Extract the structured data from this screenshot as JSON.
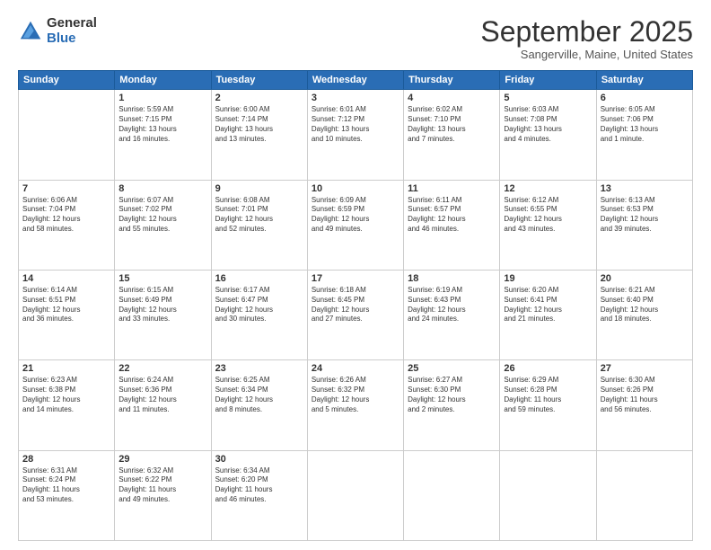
{
  "logo": {
    "general": "General",
    "blue": "Blue"
  },
  "title": "September 2025",
  "subtitle": "Sangerville, Maine, United States",
  "days": [
    "Sunday",
    "Monday",
    "Tuesday",
    "Wednesday",
    "Thursday",
    "Friday",
    "Saturday"
  ],
  "weeks": [
    [
      {
        "day": "",
        "content": ""
      },
      {
        "day": "1",
        "content": "Sunrise: 5:59 AM\nSunset: 7:15 PM\nDaylight: 13 hours\nand 16 minutes."
      },
      {
        "day": "2",
        "content": "Sunrise: 6:00 AM\nSunset: 7:14 PM\nDaylight: 13 hours\nand 13 minutes."
      },
      {
        "day": "3",
        "content": "Sunrise: 6:01 AM\nSunset: 7:12 PM\nDaylight: 13 hours\nand 10 minutes."
      },
      {
        "day": "4",
        "content": "Sunrise: 6:02 AM\nSunset: 7:10 PM\nDaylight: 13 hours\nand 7 minutes."
      },
      {
        "day": "5",
        "content": "Sunrise: 6:03 AM\nSunset: 7:08 PM\nDaylight: 13 hours\nand 4 minutes."
      },
      {
        "day": "6",
        "content": "Sunrise: 6:05 AM\nSunset: 7:06 PM\nDaylight: 13 hours\nand 1 minute."
      }
    ],
    [
      {
        "day": "7",
        "content": "Sunrise: 6:06 AM\nSunset: 7:04 PM\nDaylight: 12 hours\nand 58 minutes."
      },
      {
        "day": "8",
        "content": "Sunrise: 6:07 AM\nSunset: 7:02 PM\nDaylight: 12 hours\nand 55 minutes."
      },
      {
        "day": "9",
        "content": "Sunrise: 6:08 AM\nSunset: 7:01 PM\nDaylight: 12 hours\nand 52 minutes."
      },
      {
        "day": "10",
        "content": "Sunrise: 6:09 AM\nSunset: 6:59 PM\nDaylight: 12 hours\nand 49 minutes."
      },
      {
        "day": "11",
        "content": "Sunrise: 6:11 AM\nSunset: 6:57 PM\nDaylight: 12 hours\nand 46 minutes."
      },
      {
        "day": "12",
        "content": "Sunrise: 6:12 AM\nSunset: 6:55 PM\nDaylight: 12 hours\nand 43 minutes."
      },
      {
        "day": "13",
        "content": "Sunrise: 6:13 AM\nSunset: 6:53 PM\nDaylight: 12 hours\nand 39 minutes."
      }
    ],
    [
      {
        "day": "14",
        "content": "Sunrise: 6:14 AM\nSunset: 6:51 PM\nDaylight: 12 hours\nand 36 minutes."
      },
      {
        "day": "15",
        "content": "Sunrise: 6:15 AM\nSunset: 6:49 PM\nDaylight: 12 hours\nand 33 minutes."
      },
      {
        "day": "16",
        "content": "Sunrise: 6:17 AM\nSunset: 6:47 PM\nDaylight: 12 hours\nand 30 minutes."
      },
      {
        "day": "17",
        "content": "Sunrise: 6:18 AM\nSunset: 6:45 PM\nDaylight: 12 hours\nand 27 minutes."
      },
      {
        "day": "18",
        "content": "Sunrise: 6:19 AM\nSunset: 6:43 PM\nDaylight: 12 hours\nand 24 minutes."
      },
      {
        "day": "19",
        "content": "Sunrise: 6:20 AM\nSunset: 6:41 PM\nDaylight: 12 hours\nand 21 minutes."
      },
      {
        "day": "20",
        "content": "Sunrise: 6:21 AM\nSunset: 6:40 PM\nDaylight: 12 hours\nand 18 minutes."
      }
    ],
    [
      {
        "day": "21",
        "content": "Sunrise: 6:23 AM\nSunset: 6:38 PM\nDaylight: 12 hours\nand 14 minutes."
      },
      {
        "day": "22",
        "content": "Sunrise: 6:24 AM\nSunset: 6:36 PM\nDaylight: 12 hours\nand 11 minutes."
      },
      {
        "day": "23",
        "content": "Sunrise: 6:25 AM\nSunset: 6:34 PM\nDaylight: 12 hours\nand 8 minutes."
      },
      {
        "day": "24",
        "content": "Sunrise: 6:26 AM\nSunset: 6:32 PM\nDaylight: 12 hours\nand 5 minutes."
      },
      {
        "day": "25",
        "content": "Sunrise: 6:27 AM\nSunset: 6:30 PM\nDaylight: 12 hours\nand 2 minutes."
      },
      {
        "day": "26",
        "content": "Sunrise: 6:29 AM\nSunset: 6:28 PM\nDaylight: 11 hours\nand 59 minutes."
      },
      {
        "day": "27",
        "content": "Sunrise: 6:30 AM\nSunset: 6:26 PM\nDaylight: 11 hours\nand 56 minutes."
      }
    ],
    [
      {
        "day": "28",
        "content": "Sunrise: 6:31 AM\nSunset: 6:24 PM\nDaylight: 11 hours\nand 53 minutes."
      },
      {
        "day": "29",
        "content": "Sunrise: 6:32 AM\nSunset: 6:22 PM\nDaylight: 11 hours\nand 49 minutes."
      },
      {
        "day": "30",
        "content": "Sunrise: 6:34 AM\nSunset: 6:20 PM\nDaylight: 11 hours\nand 46 minutes."
      },
      {
        "day": "",
        "content": ""
      },
      {
        "day": "",
        "content": ""
      },
      {
        "day": "",
        "content": ""
      },
      {
        "day": "",
        "content": ""
      }
    ]
  ]
}
